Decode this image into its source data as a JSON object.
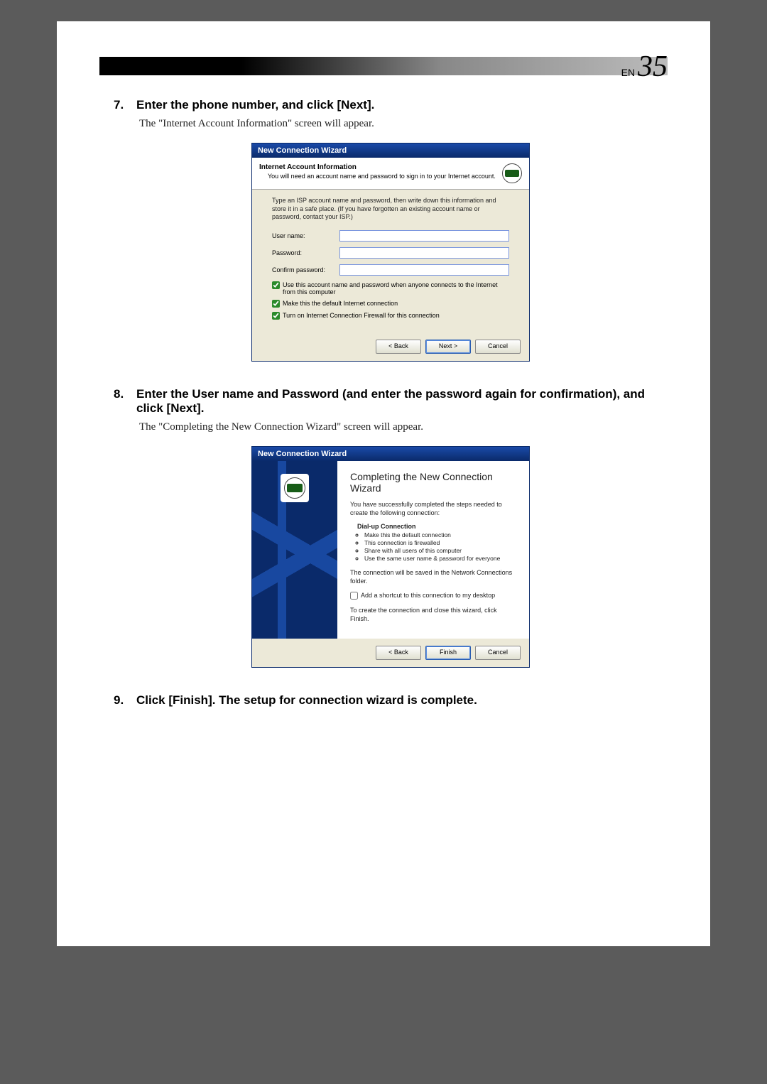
{
  "header": {
    "lang_prefix": "EN",
    "page_number": "35"
  },
  "steps": [
    {
      "num": "7.",
      "title": "Enter the phone number, and click [Next].",
      "body": "The \"Internet Account Information\" screen will appear."
    },
    {
      "num": "8.",
      "title": "Enter the User name and Password (and enter the password again for confirmation), and click [Next].",
      "body": "The \"Completing the New Connection Wizard\" screen will appear."
    },
    {
      "num": "9.",
      "title": "Click [Finish].  The setup for connection wizard is complete."
    }
  ],
  "dialog1": {
    "title": "New Connection Wizard",
    "subhead_title": "Internet Account Information",
    "subhead_desc": "You will need an account name and password to sign in to your Internet account.",
    "help": "Type an ISP account name and password, then write down this information and store it in a safe place. (If you have forgotten an existing account name or password, contact your ISP.)",
    "labels": {
      "user": "User name:",
      "pass": "Password:",
      "confirm": "Confirm password:"
    },
    "chk1": "Use this account name and password when anyone connects to the Internet from this computer",
    "chk2": "Make this the default Internet connection",
    "chk3": "Turn on Internet Connection Firewall for this connection",
    "buttons": {
      "back": "< Back",
      "next": "Next >",
      "cancel": "Cancel"
    }
  },
  "dialog2": {
    "title": "New Connection Wizard",
    "heading": "Completing the New Connection Wizard",
    "p1": "You have successfully completed the steps needed to create the following connection:",
    "conn_name": "Dial-up Connection",
    "bullets": [
      "Make this the default connection",
      "This connection is firewalled",
      "Share with all users of this computer",
      "Use the same user name & password for everyone"
    ],
    "p2": "The connection will be saved in the Network Connections folder.",
    "chk_shortcut": "Add a shortcut to this connection to my desktop",
    "p3": "To create the connection and close this wizard, click Finish.",
    "buttons": {
      "back": "< Back",
      "finish": "Finish",
      "cancel": "Cancel"
    }
  }
}
